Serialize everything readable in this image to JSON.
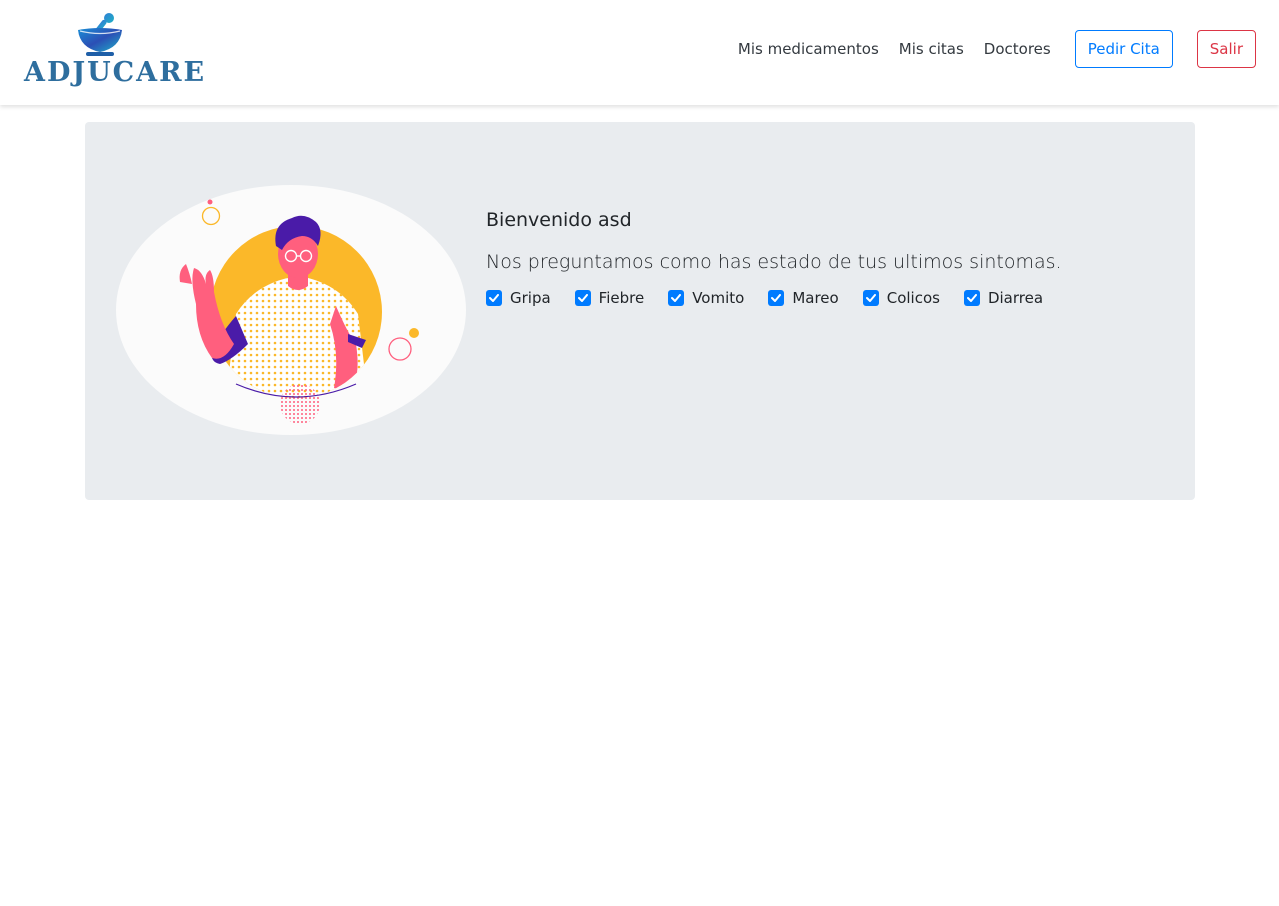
{
  "navbar": {
    "brand_name": "ADJUCARE",
    "links": [
      {
        "label": "Mis medicamentos"
      },
      {
        "label": "Mis citas"
      },
      {
        "label": "Doctores"
      }
    ],
    "request_appointment_label": "Pedir Cita",
    "logout_label": "Salir"
  },
  "welcome": {
    "title": "Bienvenido asd",
    "subtitle": "Nos preguntamos como has estado de tus ultimos sintomas.",
    "symptoms": [
      {
        "label": "Gripa",
        "checked": true
      },
      {
        "label": "Fiebre",
        "checked": true
      },
      {
        "label": "Vomito",
        "checked": true
      },
      {
        "label": "Mareo",
        "checked": true
      },
      {
        "label": "Colicos",
        "checked": true
      },
      {
        "label": "Diarrea",
        "checked": true
      }
    ]
  },
  "colors": {
    "primary": "#007bff",
    "danger": "#dc3545",
    "brand": "#2e6e9e",
    "jumbotron_bg": "#e9ecef",
    "illustration_sun": "#fbb829",
    "illustration_skin": "#ff5f7e",
    "illustration_hair": "#4a1ba8"
  },
  "icons": {
    "logo": "mortar-pestle-icon",
    "checkbox": "check-icon"
  }
}
